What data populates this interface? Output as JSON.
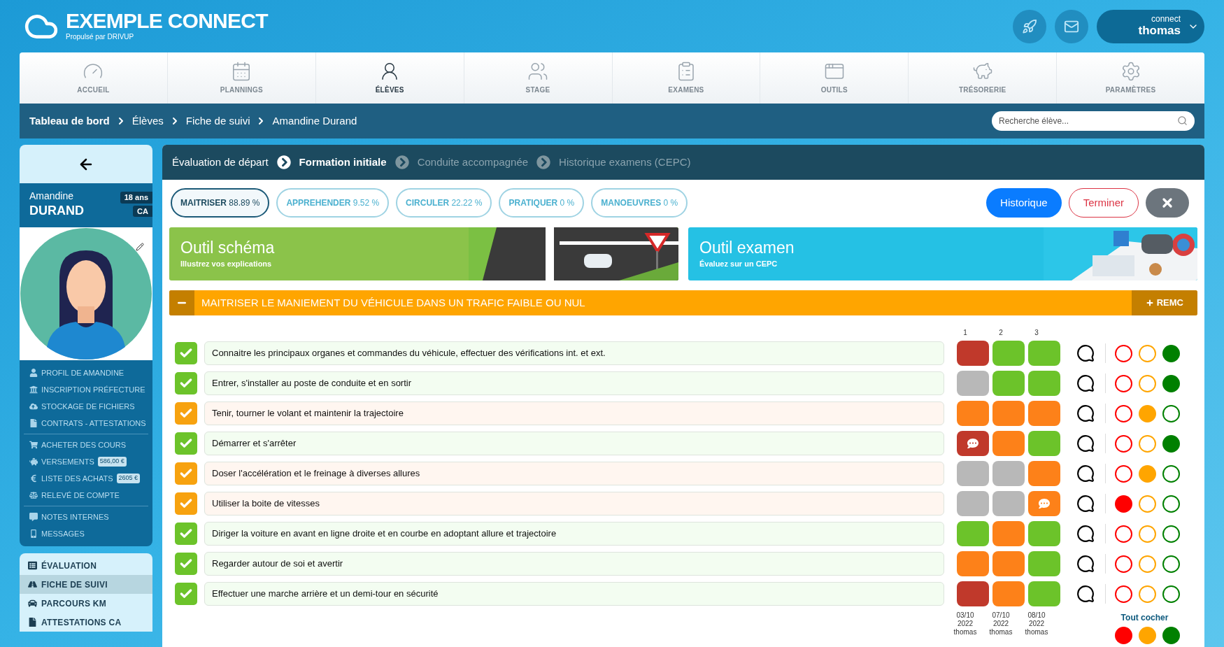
{
  "header": {
    "app_name": "EXEMPLE CONNECT",
    "tagline": "Propulsé par DRIVUP",
    "user": {
      "caption": "connect",
      "name": "thomas"
    }
  },
  "nav": [
    {
      "label": "ACCUEIL",
      "selected": false
    },
    {
      "label": "PLANNINGS",
      "selected": false
    },
    {
      "label": "ÉLÈVES",
      "selected": true
    },
    {
      "label": "STAGE",
      "selected": false
    },
    {
      "label": "EXAMENS",
      "selected": false
    },
    {
      "label": "OUTILS",
      "selected": false
    },
    {
      "label": "TRÉSORERIE",
      "selected": false
    },
    {
      "label": "PARAMÈTRES",
      "selected": false
    }
  ],
  "breadcrumb": [
    "Tableau de bord",
    "Élèves",
    "Fiche de suivi",
    "Amandine Durand"
  ],
  "search": {
    "placeholder": "Recherche élève..."
  },
  "student": {
    "first_name": "Amandine",
    "last_name": "DURAND",
    "age": "18 ans",
    "license": "CA"
  },
  "student_menu": [
    {
      "items": [
        {
          "label": "PROFIL DE AMANDINE"
        },
        {
          "label": "INSCRIPTION PRÉFECTURE"
        },
        {
          "label": "STOCKAGE DE FICHIERS"
        },
        {
          "label": "CONTRATS - ATTESTATIONS"
        }
      ]
    },
    {
      "items": [
        {
          "label": "ACHETER DES COURS"
        },
        {
          "label": "VERSEMENTS",
          "badge": "586,00 €"
        },
        {
          "label": "LISTE DES ACHATS",
          "badge": "2605 €"
        },
        {
          "label": "RELEVÉ DE COMPTE"
        }
      ]
    },
    {
      "items": [
        {
          "label": "NOTES INTERNES"
        },
        {
          "label": "MESSAGES"
        }
      ]
    }
  ],
  "sections_nav": [
    {
      "label": "ÉVALUATION",
      "selected": false
    },
    {
      "label": "FICHE DE SUIVI",
      "selected": true
    },
    {
      "label": "PARCOURS KM",
      "selected": false
    },
    {
      "label": "ATTESTATIONS CA",
      "selected": false
    }
  ],
  "steps": [
    {
      "label": "Évaluation de départ",
      "selected": false,
      "disabled": false
    },
    {
      "label": "Formation initiale",
      "selected": true,
      "disabled": false
    },
    {
      "label": "Conduite accompagnée",
      "selected": false,
      "disabled": true
    },
    {
      "label": "Historique examens (CEPC)",
      "selected": false,
      "disabled": true
    }
  ],
  "skill_tabs": [
    {
      "label": "**MAITRISER** 88.89 %",
      "selected": true
    },
    {
      "label": "**APPREHENDER** 9.52 %",
      "selected": false
    },
    {
      "label": "**CIRCULER** 22.22 %",
      "selected": false
    },
    {
      "label": "**PRATIQUER** 0 %",
      "selected": false
    },
    {
      "label": "**MANOEUVRES** 0 %",
      "selected": false
    }
  ],
  "actions": [
    {
      "label": "Historique",
      "kind": "primary"
    },
    {
      "label": "Terminer",
      "kind": "outline"
    },
    {
      "kind": "close"
    }
  ],
  "tools": [
    {
      "title": "Outil schéma",
      "subtitle": "Illustrez vos explications",
      "kind": "schema"
    },
    {
      "title": "Outil examen",
      "subtitle": "Évaluez sur un CEPC",
      "kind": "exam"
    }
  ],
  "competence": {
    "title": "MAITRISER LE MANIEMENT DU VÉHICULE DANS UN TRAFIC FAIBLE OU NUL",
    "remc_label": "REMC"
  },
  "session_columns": [
    {
      "number": "1",
      "date": "03/10",
      "year": "2022",
      "instructor": "thomas"
    },
    {
      "number": "2",
      "date": "07/10",
      "year": "2022",
      "instructor": "thomas"
    },
    {
      "number": "3",
      "date": "08/10",
      "year": "2022",
      "instructor": "thomas"
    }
  ],
  "rows": [
    {
      "label": "Connaitre les principaux organes et commandes du véhicule, effectuer des vérifications int. et ext.",
      "kind": "acquired",
      "sessions": [
        {
          "color": "#c0392b",
          "comment": false
        },
        {
          "color": "#6cc32a",
          "comment": false
        },
        {
          "color": "#6cc32a",
          "comment": false
        }
      ],
      "lights": [
        {
          "color": "#ff0000",
          "selected": false
        },
        {
          "color": "#ffa500",
          "selected": false
        },
        {
          "color": "#008000",
          "selected": true
        }
      ]
    },
    {
      "label": "Entrer, s'installer au poste de conduite et en sortir",
      "kind": "acquired",
      "sessions": [
        {
          "color": "#b8b8b8",
          "comment": false
        },
        {
          "color": "#6cc32a",
          "comment": false
        },
        {
          "color": "#6cc32a",
          "comment": false
        }
      ],
      "lights": [
        {
          "color": "#ff0000",
          "selected": false
        },
        {
          "color": "#ffa500",
          "selected": false
        },
        {
          "color": "#008000",
          "selected": true
        }
      ]
    },
    {
      "label": "Tenir, tourner le volant et maintenir la trajectoire",
      "kind": "partial",
      "sessions": [
        {
          "color": "#fd8119",
          "comment": false
        },
        {
          "color": "#fd8119",
          "comment": false
        },
        {
          "color": "#fd8119",
          "comment": false
        }
      ],
      "lights": [
        {
          "color": "#ff0000",
          "selected": false
        },
        {
          "color": "#ffa500",
          "selected": true
        },
        {
          "color": "#008000",
          "selected": false
        }
      ]
    },
    {
      "label": "Démarrer et s'arrêter",
      "kind": "acquired",
      "sessions": [
        {
          "color": "#c0392b",
          "comment": true
        },
        {
          "color": "#fd8119",
          "comment": false
        },
        {
          "color": "#6cc32a",
          "comment": false
        }
      ],
      "lights": [
        {
          "color": "#ff0000",
          "selected": false
        },
        {
          "color": "#ffa500",
          "selected": false
        },
        {
          "color": "#008000",
          "selected": true
        }
      ]
    },
    {
      "label": "Doser l'accélération et le freinage à diverses allures",
      "kind": "partial",
      "sessions": [
        {
          "color": "#b8b8b8",
          "comment": false
        },
        {
          "color": "#b8b8b8",
          "comment": false
        },
        {
          "color": "#fd8119",
          "comment": false
        }
      ],
      "lights": [
        {
          "color": "#ff0000",
          "selected": false
        },
        {
          "color": "#ffa500",
          "selected": true
        },
        {
          "color": "#008000",
          "selected": false
        }
      ]
    },
    {
      "label": "Utiliser la boite de vitesses",
      "kind": "partial",
      "sessions": [
        {
          "color": "#b8b8b8",
          "comment": false
        },
        {
          "color": "#b8b8b8",
          "comment": false
        },
        {
          "color": "#fd8119",
          "comment": true
        }
      ],
      "lights": [
        {
          "color": "#ff0000",
          "selected": true
        },
        {
          "color": "#ffa500",
          "selected": false
        },
        {
          "color": "#008000",
          "selected": false
        }
      ]
    },
    {
      "label": "Diriger la voiture en avant en ligne droite et en courbe en adoptant allure et trajectoire",
      "kind": "acquired",
      "sessions": [
        {
          "color": "#6cc32a",
          "comment": false
        },
        {
          "color": "#fd8119",
          "comment": false
        },
        {
          "color": "#6cc32a",
          "comment": false
        }
      ],
      "lights": [
        {
          "color": "#ff0000",
          "selected": false
        },
        {
          "color": "#ffa500",
          "selected": false
        },
        {
          "color": "#008000",
          "selected": false
        }
      ]
    },
    {
      "label": "Regarder autour de soi et avertir",
      "kind": "acquired",
      "sessions": [
        {
          "color": "#fd8119",
          "comment": false
        },
        {
          "color": "#fd8119",
          "comment": false
        },
        {
          "color": "#6cc32a",
          "comment": false
        }
      ],
      "lights": [
        {
          "color": "#ff0000",
          "selected": false
        },
        {
          "color": "#ffa500",
          "selected": false
        },
        {
          "color": "#008000",
          "selected": false
        }
      ]
    },
    {
      "label": "Effectuer une marche arrière et un demi-tour en sécurité",
      "kind": "acquired",
      "sessions": [
        {
          "color": "#c0392b",
          "comment": false
        },
        {
          "color": "#fd8119",
          "comment": false
        },
        {
          "color": "#6cc32a",
          "comment": false
        }
      ],
      "lights": [
        {
          "color": "#ff0000",
          "selected": false
        },
        {
          "color": "#ffa500",
          "selected": false
        },
        {
          "color": "#008000",
          "selected": false
        }
      ]
    }
  ],
  "check_all": {
    "label": "Tout cocher",
    "buttons": [
      {
        "color": "#ff0000"
      },
      {
        "color": "#ffa500"
      },
      {
        "color": "#008000"
      }
    ]
  }
}
